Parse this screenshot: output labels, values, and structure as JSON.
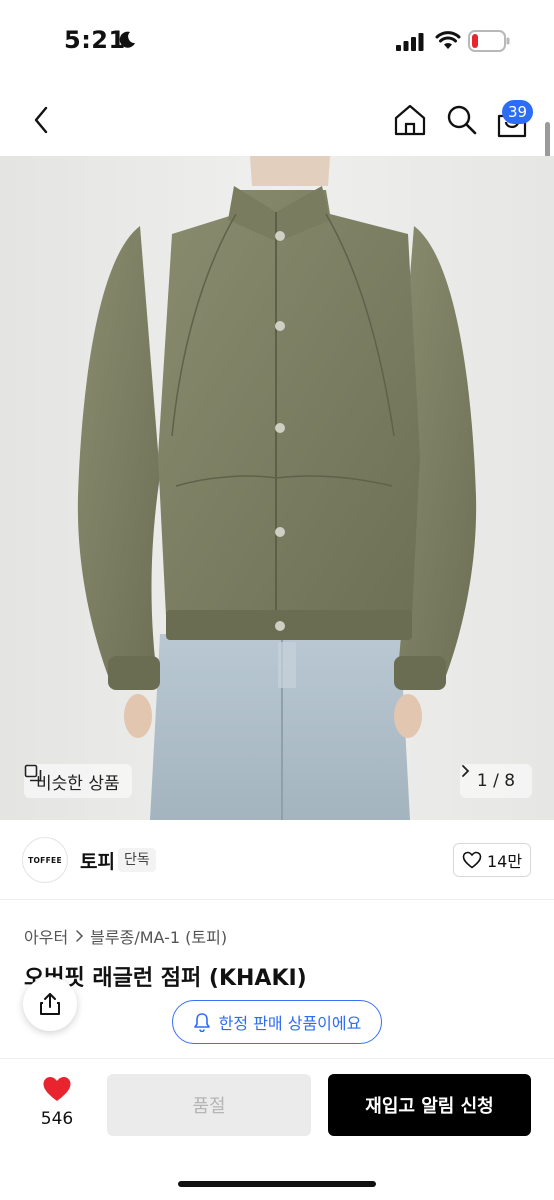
{
  "status_bar": {
    "time": "5:21"
  },
  "nav": {
    "cart_count": "39"
  },
  "hero": {
    "similar_label": "비슷한 상품",
    "page_indicator": "1 / 8",
    "page_current": 1,
    "page_total": 8
  },
  "brand": {
    "logo_text": "TOFFEE",
    "name": "토피",
    "tag": "단독",
    "likes": "14만"
  },
  "product": {
    "breadcrumb": [
      "아우터",
      "블루종/MA-1 (토피)"
    ],
    "title": "오버핏 래글런 점퍼 (KHAKI)"
  },
  "floating": {
    "limited_label": "한정 판매 상품이에요"
  },
  "bottom": {
    "heart_count": "546",
    "soldout_label": "품절",
    "restock_label": "재입고 알림 신청"
  },
  "colors": {
    "accent_blue": "#2d6df6",
    "heart_red": "#e8242e",
    "jacket_khaki": "#7d7f62"
  }
}
